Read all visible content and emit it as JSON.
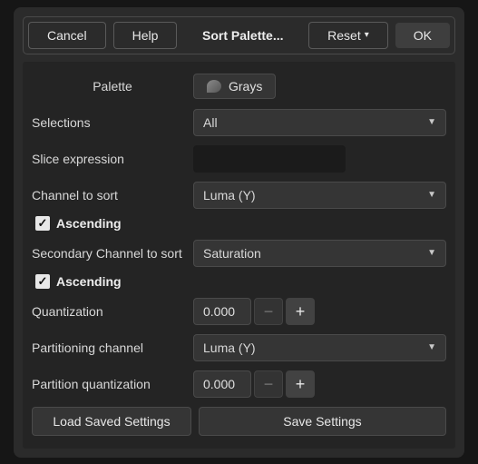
{
  "header": {
    "cancel": "Cancel",
    "help": "Help",
    "title": "Sort Palette...",
    "reset": "Reset",
    "ok": "OK"
  },
  "labels": {
    "palette": "Palette",
    "selections": "Selections",
    "slice": "Slice expression",
    "channel": "Channel to sort",
    "ascending": "Ascending",
    "secondary": "Secondary Channel to sort",
    "quantization": "Quantization",
    "partitioning": "Partitioning channel",
    "partitionQuant": "Partition quantization"
  },
  "values": {
    "paletteName": "Grays",
    "selections": "All",
    "slice": "",
    "channel": "Luma (Y)",
    "secondary": "Saturation",
    "quantization": "0.000",
    "partitioning": "Luma (Y)",
    "partitionQuant": "0.000"
  },
  "footer": {
    "load": "Load Saved Settings",
    "save": "Save Settings"
  }
}
